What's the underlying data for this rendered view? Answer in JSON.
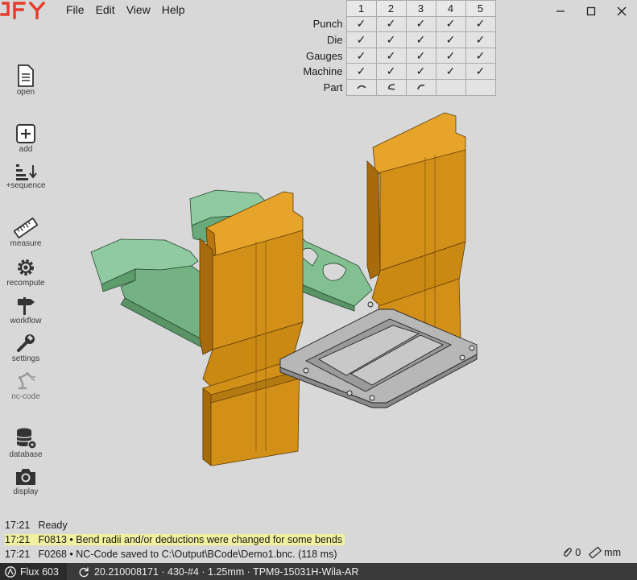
{
  "app": {
    "logo_text": "JFY",
    "logo_color": "#e53a2a"
  },
  "menu": [
    {
      "id": "file",
      "label": "File"
    },
    {
      "id": "edit",
      "label": "Edit"
    },
    {
      "id": "view",
      "label": "View"
    },
    {
      "id": "help",
      "label": "Help"
    }
  ],
  "window_controls": [
    "minimize-icon",
    "maximize-icon",
    "close-icon"
  ],
  "sidebar": [
    {
      "id": "open",
      "label": "open",
      "icon": "document-icon"
    },
    {
      "id": "add",
      "label": "add",
      "icon": "plus-box-icon"
    },
    {
      "id": "sequence",
      "label": "+sequence",
      "icon": "sort-down-icon"
    },
    {
      "id": "measure",
      "label": "measure",
      "icon": "ruler-icon"
    },
    {
      "id": "recompute",
      "label": "recompute",
      "icon": "gear-icon"
    },
    {
      "id": "workflow",
      "label": "workflow",
      "icon": "signpost-icon"
    },
    {
      "id": "settings",
      "label": "settings",
      "icon": "wrench-icon"
    },
    {
      "id": "nccode",
      "label": "nc-code",
      "icon": "robot-arm-icon"
    },
    {
      "id": "database",
      "label": "database",
      "icon": "database-icon"
    },
    {
      "id": "display",
      "label": "display",
      "icon": "camera-icon"
    }
  ],
  "status_table": {
    "columns": [
      "1",
      "2",
      "3",
      "4",
      "5"
    ],
    "rows": [
      {
        "label": "Punch",
        "cells": [
          "✓",
          "✓",
          "✓",
          "✓",
          "✓"
        ]
      },
      {
        "label": "Die",
        "cells": [
          "✓",
          "✓",
          "✓",
          "✓",
          "✓"
        ]
      },
      {
        "label": "Gauges",
        "cells": [
          "✓",
          "✓",
          "✓",
          "✓",
          "✓"
        ]
      },
      {
        "label": "Machine",
        "cells": [
          "✓",
          "✓",
          "✓",
          "✓",
          "✓"
        ]
      },
      {
        "label": "Part",
        "cells": [
          "bend-shape",
          "bend-shape",
          "bend-shape",
          "",
          ""
        ]
      }
    ]
  },
  "log": [
    {
      "time": "17:21",
      "code": "",
      "message": "Ready",
      "warn": false
    },
    {
      "time": "17:21",
      "code": "F0813",
      "message": "• Bend radii and/or deductions were changed for some bends",
      "warn": true
    },
    {
      "time": "17:21",
      "code": "F0268",
      "message": "• NC-Code saved to C:\\Output\\BCode\\Demo1.bnc. (118 ms)",
      "warn": false
    }
  ],
  "statusbar": {
    "brand": "Flux 603",
    "info": "20.210008171 · 430-#4 · 1.25mm · TPM9-15031H-Wila-AR",
    "attachments": "0",
    "unit": "mm"
  },
  "colors": {
    "tool_orange": "#d9961d",
    "gauge_green": "#7fb98a",
    "part_gray": "#b9b9b9"
  }
}
